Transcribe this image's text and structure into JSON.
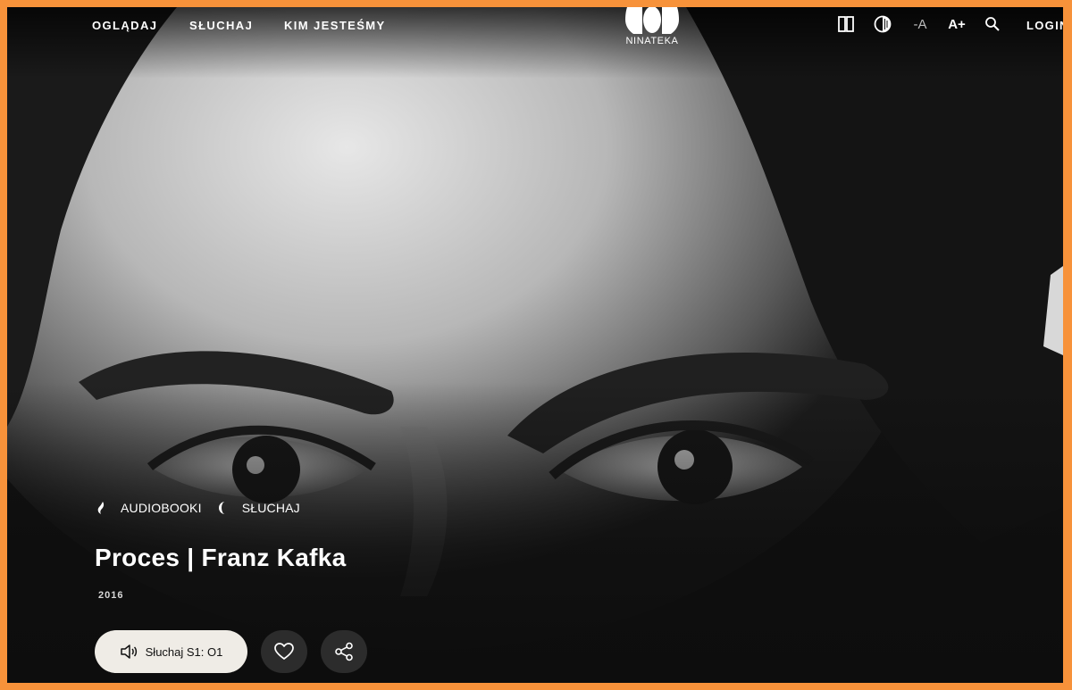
{
  "header": {
    "nav": [
      {
        "label": "OGLĄDAJ"
      },
      {
        "label": "SŁUCHAJ"
      },
      {
        "label": "KIM JESTEŚMY"
      }
    ],
    "logo_text": "NINATEKA",
    "tools": {
      "layout_icon": "columns-icon",
      "contrast_icon": "contrast-icon",
      "font_smaller": "-A",
      "font_larger": "A+",
      "search_icon": "search-icon"
    },
    "login": "LOGIN"
  },
  "content": {
    "tags": [
      {
        "icon": "audiobook-icon",
        "label": "AUDIOBOOKI"
      },
      {
        "icon": "listen-icon",
        "label": "SŁUCHAJ"
      }
    ],
    "title": "Proces | Franz Kafka",
    "year": "2016",
    "listen_button": {
      "icon": "speaker-icon",
      "label": "Słuchaj S1: O1"
    },
    "favorite_icon": "heart-icon",
    "share_icon": "share-icon"
  },
  "colors": {
    "frame_border": "#f7923a",
    "background": "#0d0d0d",
    "button_light": "#efece6",
    "button_dark": "#2c2c2c"
  }
}
